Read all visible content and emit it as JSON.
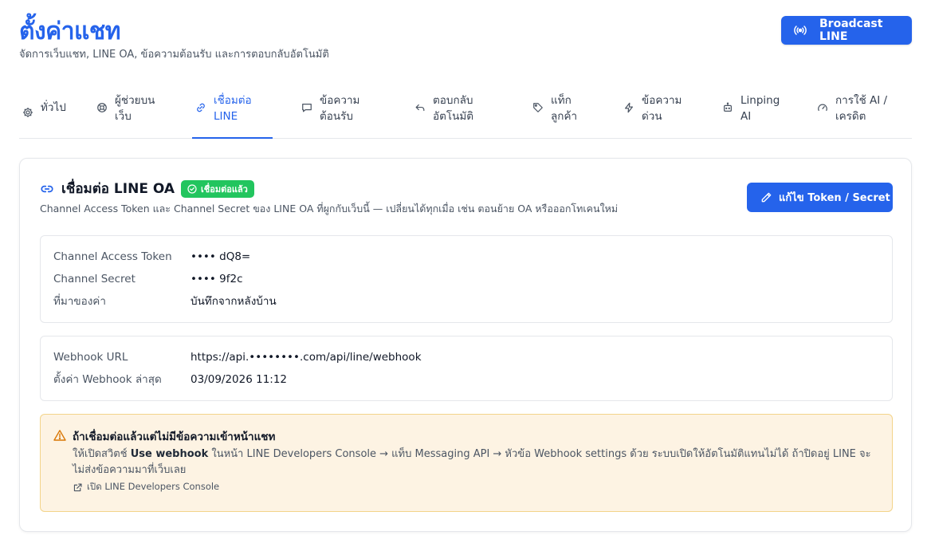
{
  "header": {
    "title": "ตั้งค่าแชท",
    "subtitle": "จัดการเว็บแชท, LINE OA, ข้อความต้อนรับ และการตอบกลับอัตโนมัติ",
    "broadcast_label": "Broadcast LINE"
  },
  "tabs": [
    {
      "line1": "ทั่วไป",
      "line2": "",
      "icon": "gear-icon"
    },
    {
      "line1": "ผู้ช่วยบน",
      "line2": "เว็บ",
      "icon": "lifebuoy-icon"
    },
    {
      "line1": "เชื่อมต่อ",
      "line2": "LINE",
      "icon": "link-icon",
      "active": true
    },
    {
      "line1": "ข้อความ",
      "line2": "ต้อนรับ",
      "icon": "message-icon"
    },
    {
      "line1": "ตอบกลับ",
      "line2": "อัตโนมัติ",
      "icon": "reply-icon"
    },
    {
      "line1": "แท็ก",
      "line2": "ลูกค้า",
      "icon": "tag-icon"
    },
    {
      "line1": "ข้อความ",
      "line2": "ด่วน",
      "icon": "bolt-icon"
    },
    {
      "line1": "Linping",
      "line2": "AI",
      "icon": "bot-icon"
    },
    {
      "line1": "การใช้ AI /",
      "line2": "เครดิต",
      "icon": "gauge-icon"
    }
  ],
  "card": {
    "title": "เชื่อมต่อ LINE OA",
    "badge": "เชื่อมต่อแล้ว",
    "description": "Channel Access Token และ Channel Secret ของ LINE OA ที่ผูกกับเว็บนี้ — เปลี่ยนได้ทุกเมื่อ เช่น ตอนย้าย OA หรือออกโทเคนใหม่",
    "edit_label": "แก้ไข Token / Secret",
    "credentials": [
      {
        "key": "Channel Access Token",
        "value": "•••• dQ8="
      },
      {
        "key": "Channel Secret",
        "value": "•••• 9f2c"
      },
      {
        "key": "ที่มาของค่า",
        "value": "บันทึกจากหลังบ้าน"
      }
    ],
    "webhook": [
      {
        "key": "Webhook URL",
        "value": "https://api.••••••••.com/api/line/webhook"
      },
      {
        "key": "ตั้งค่า Webhook ล่าสุด",
        "value": "03/09/2026 11:12"
      }
    ]
  },
  "warning": {
    "title": "ถ้าเชื่อมต่อแล้วแต่ไม่มีข้อความเข้าหน้าแชท",
    "body_pre": "ให้เปิดสวิตช์ ",
    "body_bold": "Use webhook",
    "body_post": " ในหน้า LINE Developers Console → แท็บ Messaging API → หัวข้อ Webhook settings ด้วย ระบบเปิดให้อัตโนมัติแทนไม่ได้ ถ้าปิดอยู่ LINE จะไม่ส่งข้อความมาที่เว็บเลย",
    "link_label": "เปิด LINE Developers Console"
  },
  "colors": {
    "primary": "#2563eb",
    "success": "#22c55e",
    "warning_bg": "#fdf3e3",
    "warning_border": "#f3d48a",
    "warning_icon": "#d97706"
  }
}
